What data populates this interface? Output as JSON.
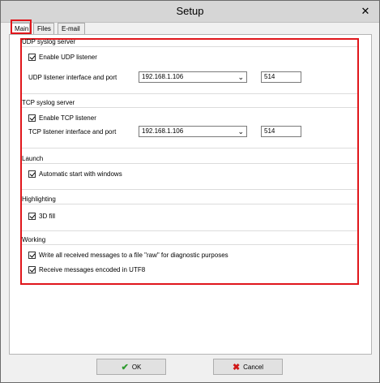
{
  "window": {
    "title": "Setup",
    "close_glyph": "✕"
  },
  "tabs": [
    {
      "label": "Main",
      "active": true
    },
    {
      "label": "Files",
      "active": false
    },
    {
      "label": "E-mail",
      "active": false
    }
  ],
  "udp": {
    "title": "UDP syslog server",
    "enable_label": "Enable UDP listener",
    "interface_label": "UDP listener interface and port",
    "interface_value": "192.168.1.106",
    "port_value": "514"
  },
  "tcp": {
    "title": "TCP syslog server",
    "enable_label": "Enable TCP listener",
    "interface_label": "TCP listener interface and port",
    "interface_value": "192.168.1.106",
    "port_value": "514"
  },
  "launch": {
    "title": "Launch",
    "autostart_label": "Automatic start with windows"
  },
  "highlighting": {
    "title": "Highlighting",
    "fill3d_label": "3D fill"
  },
  "working": {
    "title": "Working",
    "raw_label": "Write all received messages to a file \"raw\" for diagnostic purposes",
    "utf8_label": "Receive messages encoded in UTF8"
  },
  "buttons": {
    "ok_label": "OK",
    "cancel_label": "Cancel",
    "ok_icon": "✔",
    "cancel_icon": "✖"
  },
  "colors": {
    "highlight": "#e0161b",
    "ok_icon": "#2e9b2e",
    "cancel_icon": "#d01818"
  }
}
